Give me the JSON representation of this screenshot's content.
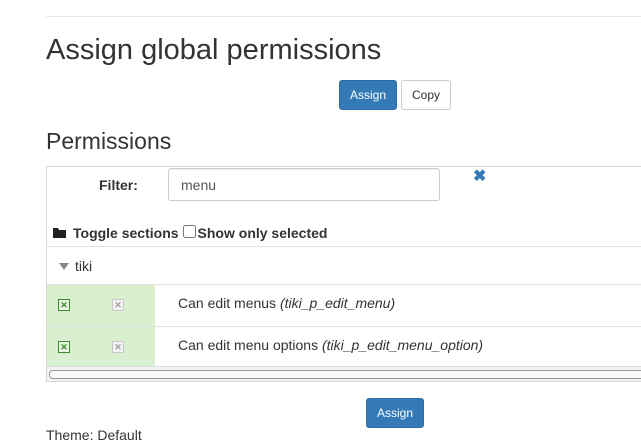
{
  "page": {
    "title": "Assign global permissions",
    "assign_label": "Assign",
    "copy_label": "Copy"
  },
  "permissions": {
    "title": "Permissions",
    "filter_label": "Filter:",
    "filter_value": "menu",
    "clear_icon": "close-icon",
    "toggle_sections_label": "Toggle sections",
    "show_only_selected_label": "Show only selected",
    "groups": [
      {
        "label": "tiki",
        "rows": [
          {
            "label": "Can edit menus",
            "code": "(tiki_p_edit_menu)",
            "checked": true
          },
          {
            "label": "Can edit menu options",
            "code": "(tiki_p_edit_menu_option)",
            "checked": true
          }
        ]
      }
    ],
    "assign_bottom_label": "Assign"
  },
  "next_section": {
    "label": "Theme: Default"
  },
  "colors": {
    "accent": "#337ab7",
    "selected_cell": "#d9f0d0"
  }
}
